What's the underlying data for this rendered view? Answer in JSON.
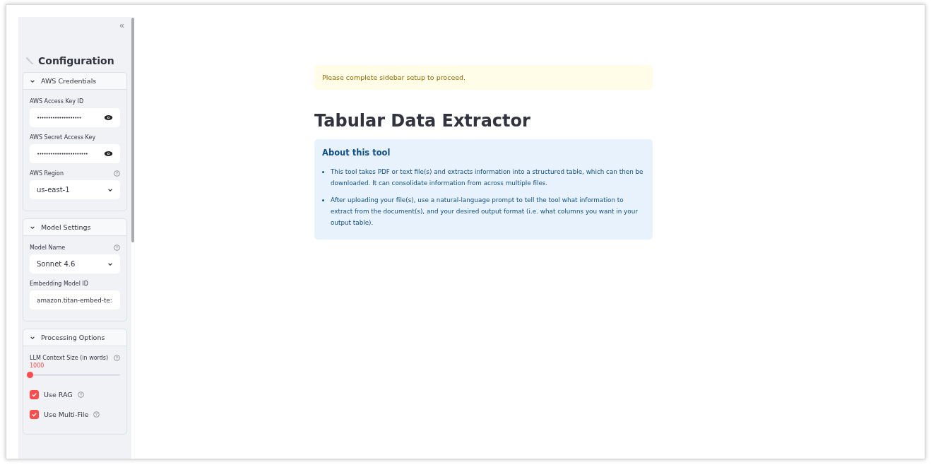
{
  "sidebar": {
    "collapse_icon": "«",
    "title": "Configuration",
    "sections": [
      {
        "title": "AWS Credentials",
        "expanded": true,
        "fields": [
          {
            "kind": "password",
            "label": "AWS Access Key ID",
            "value": "••••••••••••••••••••"
          },
          {
            "kind": "password",
            "label": "AWS Secret Access Key",
            "value": "•••••••••••••••••••••••"
          },
          {
            "kind": "select",
            "label": "AWS Region",
            "help": true,
            "value": "us-east-1"
          }
        ]
      },
      {
        "title": "Model Settings",
        "expanded": true,
        "fields": [
          {
            "kind": "select",
            "label": "Model Name",
            "help": true,
            "value": "Sonnet 4.6"
          },
          {
            "kind": "text",
            "label": "Embedding Model ID",
            "value": "amazon.titan-embed-te:"
          }
        ]
      },
      {
        "title": "Processing Options",
        "expanded": true,
        "fields": [
          {
            "kind": "slider",
            "label": "LLM Context Size (in words)",
            "help": true,
            "reading": "1000",
            "level": 0
          },
          {
            "kind": "checkbox",
            "label": "Use RAG",
            "help": true,
            "checked": true
          },
          {
            "kind": "checkbox",
            "label": "Use Multi-File",
            "help": true,
            "checked": true
          }
        ]
      }
    ]
  },
  "main": {
    "warning": "Please complete sidebar setup to proceed.",
    "title": "Tabular Data Extractor",
    "info": {
      "heading": "About this tool",
      "bullets": [
        "This tool takes PDF or text file(s) and extracts information into a structured table, which can then be downloaded. It can consolidate information from across multiple files.",
        "After uploading your file(s), use a natural-language prompt to tell the tool what information to extract from the document(s), and your desired output format (i.e. what columns you want in your output table)."
      ]
    }
  }
}
